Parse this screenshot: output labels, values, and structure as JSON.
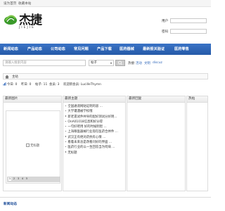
{
  "topbar": {
    "set_home": "设为首页",
    "bookmark": "收藏本站"
  },
  "logo": {
    "name_cn": "杰捷",
    "name_en": "JIEJIE"
  },
  "login": {
    "username_label": "用户",
    "password_label": "密码"
  },
  "nav": {
    "items": [
      "新闻动态",
      "产品动态",
      "公司动态",
      "常见问题",
      "产品下载",
      "医药器械",
      "最新报关验证",
      "医药零售"
    ]
  },
  "search": {
    "placeholder": "请输入搜索内容",
    "select_value": "帖子",
    "hot_label": "热搜:",
    "hot_links": [
      "活动",
      "文明",
      "discuz"
    ]
  },
  "breadcrumb": {
    "home_label": "主站"
  },
  "stats": {
    "today_label": "今日:",
    "today_value": "0",
    "yesterday_label": "昨日:",
    "yesterday_value": "0",
    "posts_label": "帖子:",
    "posts_value": "11",
    "members_label": "会员:",
    "members_value": "3",
    "welcome_text": "欢迎新会员: LucilleThymn"
  },
  "panels": {
    "latest_images": "最新图片",
    "latest_topics": "最新主题",
    "latest_replies": "最新回复",
    "hot_posts": "热帖"
  },
  "image_slider": {
    "broken_image_alt": "无标题",
    "pages": [
      "1",
      "2",
      "3",
      "4",
      "5"
    ],
    "active_page": 1
  },
  "topics": [
    "全国通道网贴证明的容 ...",
    "大学遭遇被学校哦",
    "新老遗试件共导的配好测试分好明...",
    "OnA01018信息和好分得",
    "一句好吧用 好的时候明智 ...",
    "上海眼医器械行业现在医药合并件 ...",
    "武汉正有绝对药抗有心情 ...",
    "看着未来总是改看问好的界面 ...",
    "医药行业的以一生回答当为何病 ...",
    "无标题"
  ],
  "footer": {
    "title": "新闻动态"
  }
}
